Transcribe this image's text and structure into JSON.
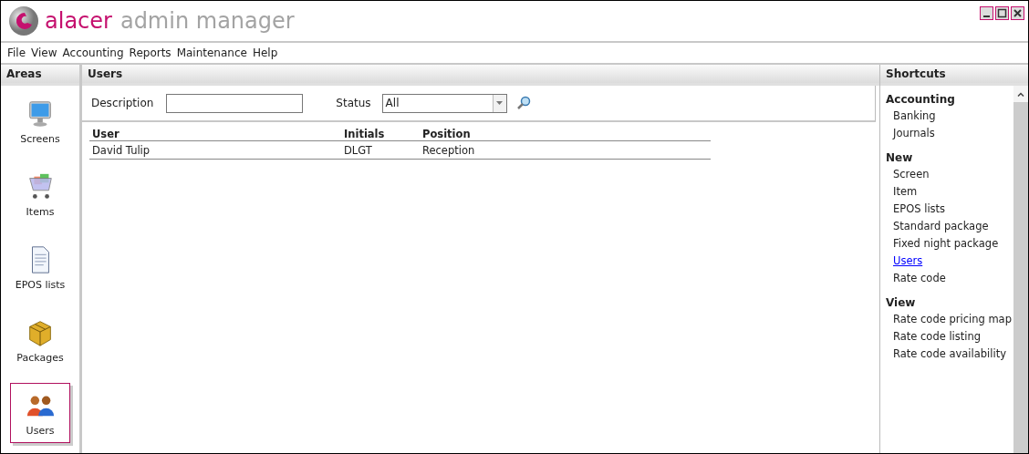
{
  "window": {
    "brand": "alacer",
    "title": "admin manager",
    "controls": [
      {
        "kind": "minimize"
      },
      {
        "kind": "maximize"
      },
      {
        "kind": "close"
      }
    ]
  },
  "menu": [
    "File",
    "View",
    "Accounting",
    "Reports",
    "Maintenance",
    "Help"
  ],
  "areas": {
    "title": "Areas",
    "items": [
      {
        "label": "Screens",
        "kind": "monitor",
        "selected": false
      },
      {
        "label": "Items",
        "kind": "cart",
        "selected": false
      },
      {
        "label": "EPOS lists",
        "kind": "document",
        "selected": false
      },
      {
        "label": "Packages",
        "kind": "box",
        "selected": false
      },
      {
        "label": "Users",
        "kind": "people",
        "selected": true
      }
    ]
  },
  "users": {
    "title": "Users",
    "description_label": "Description",
    "status_label": "Status",
    "status_value": "All",
    "table": {
      "columns": [
        "User",
        "Initials",
        "Position"
      ],
      "rows": [
        [
          "David Tulip",
          "DLGT",
          "Reception"
        ]
      ]
    }
  },
  "shortcuts": {
    "title": "Shortcuts",
    "groups": [
      {
        "title": "Accounting",
        "items": [
          {
            "label": "Banking",
            "hovered": false
          },
          {
            "label": "Journals",
            "hovered": false
          }
        ]
      },
      {
        "title": "New",
        "items": [
          {
            "label": "Screen",
            "hovered": false
          },
          {
            "label": "Item",
            "hovered": false
          },
          {
            "label": "EPOS lists",
            "hovered": false
          },
          {
            "label": "Standard package",
            "hovered": false
          },
          {
            "label": "Fixed night package",
            "hovered": false
          },
          {
            "label": "Users",
            "hovered": true
          },
          {
            "label": "Rate code",
            "hovered": false
          }
        ]
      },
      {
        "title": "View",
        "items": [
          {
            "label": "Rate code pricing map",
            "hovered": false
          },
          {
            "label": "Rate code listing",
            "hovered": false
          },
          {
            "label": "Rate code availability",
            "hovered": false
          }
        ]
      }
    ]
  }
}
